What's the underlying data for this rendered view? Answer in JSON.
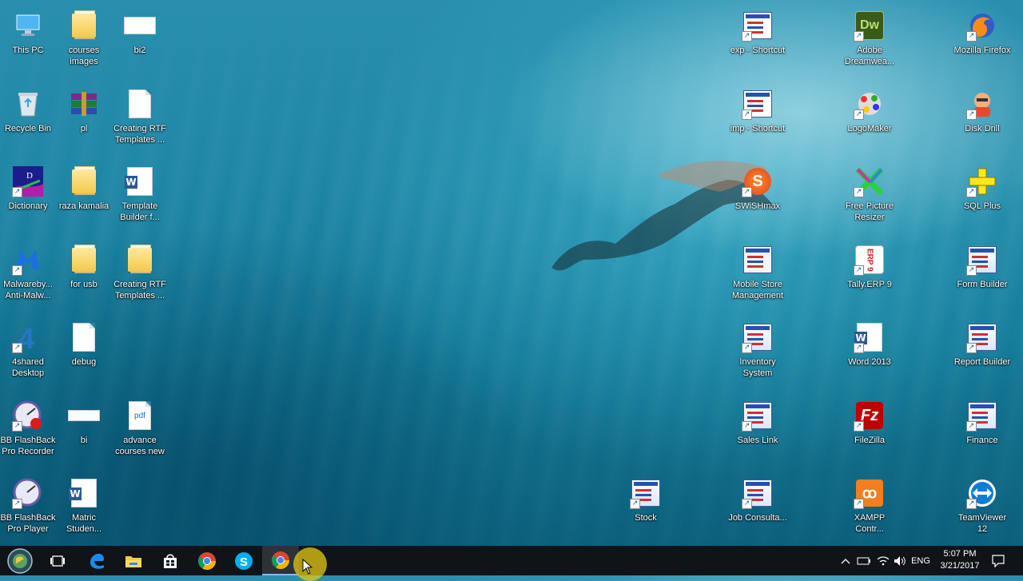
{
  "desktop": {
    "icons": [
      {
        "label": "This PC",
        "icon": "computer-icon"
      },
      {
        "label": "courses images",
        "icon": "folder-icon"
      },
      {
        "label": "bi2",
        "icon": "image-file-icon"
      },
      {
        "label": "Recycle Bin",
        "icon": "recycle-bin-icon"
      },
      {
        "label": "pl",
        "icon": "archive-icon"
      },
      {
        "label": "Creating RTF Templates ...",
        "icon": "document-icon"
      },
      {
        "label": "Dictionary",
        "icon": "dictionary-app-icon"
      },
      {
        "label": "raza kamalia",
        "icon": "folder-icon"
      },
      {
        "label": "Template Builder f...",
        "icon": "word-document-icon"
      },
      {
        "label": "Malwareby... Anti-Malw...",
        "icon": "malwarebytes-icon"
      },
      {
        "label": "for usb",
        "icon": "folder-icon"
      },
      {
        "label": "Creating RTF Templates ...",
        "icon": "folder-icon"
      },
      {
        "label": "4shared Desktop",
        "icon": "4shared-icon"
      },
      {
        "label": "debug",
        "icon": "text-file-icon"
      },
      {
        "label": "BB FlashBack Pro Recorder",
        "icon": "flashback-recorder-icon"
      },
      {
        "label": "bi",
        "icon": "image-file-icon"
      },
      {
        "label": "advance courses new",
        "icon": "pdf-file-icon"
      },
      {
        "label": "BB FlashBack Pro Player",
        "icon": "flashback-player-icon"
      },
      {
        "label": "Matric Studen...",
        "icon": "word-document-icon"
      },
      {
        "label": "exp - Shortcut",
        "icon": "app-shortcut-icon"
      },
      {
        "label": "imp - Shortcut",
        "icon": "app-shortcut-icon"
      },
      {
        "label": "SWiSHmax",
        "icon": "swishmax-icon"
      },
      {
        "label": "Mobile Store Management",
        "icon": "app-icon"
      },
      {
        "label": "Inventory System",
        "icon": "vb-app-icon"
      },
      {
        "label": "Sales Link",
        "icon": "vb-app-icon"
      },
      {
        "label": "Stock",
        "icon": "vb-app-icon"
      },
      {
        "label": "Job Consulta...",
        "icon": "vb-app-icon"
      },
      {
        "label": "Adobe Dreamwea...",
        "icon": "dreamweaver-icon"
      },
      {
        "label": "LogoMaker",
        "icon": "logomaker-icon"
      },
      {
        "label": "Free Picture Resizer",
        "icon": "picture-resizer-icon"
      },
      {
        "label": "Tally.ERP 9",
        "icon": "tally-icon"
      },
      {
        "label": "Word 2013",
        "icon": "word-icon"
      },
      {
        "label": "FileZilla",
        "icon": "filezilla-icon"
      },
      {
        "label": "XAMPP Contr...",
        "icon": "xampp-icon"
      },
      {
        "label": "Mozilla Firefox",
        "icon": "firefox-icon"
      },
      {
        "label": "Disk Drill",
        "icon": "disk-drill-icon"
      },
      {
        "label": "SQL Plus",
        "icon": "sqlplus-icon"
      },
      {
        "label": "Form Builder",
        "icon": "form-builder-icon"
      },
      {
        "label": "Report Builder",
        "icon": "report-builder-icon"
      },
      {
        "label": "Finance",
        "icon": "vb-app-icon"
      },
      {
        "label": "TeamViewer 12",
        "icon": "teamviewer-icon"
      }
    ]
  },
  "taskbar": {
    "buttons": [
      {
        "icon": "start-icon"
      },
      {
        "icon": "task-view-icon"
      },
      {
        "icon": "edge-icon"
      },
      {
        "icon": "file-explorer-icon"
      },
      {
        "icon": "store-icon"
      },
      {
        "icon": "chrome-icon"
      },
      {
        "icon": "skype-icon"
      },
      {
        "icon": "chrome-icon"
      }
    ],
    "tray": {
      "language": "ENG",
      "time": "5:07 PM",
      "date": "3/21/2017"
    }
  },
  "colors": {
    "taskbar": "#101418",
    "active_indicator": "#8ab4f8",
    "cursor_highlight": "#e6c814"
  }
}
